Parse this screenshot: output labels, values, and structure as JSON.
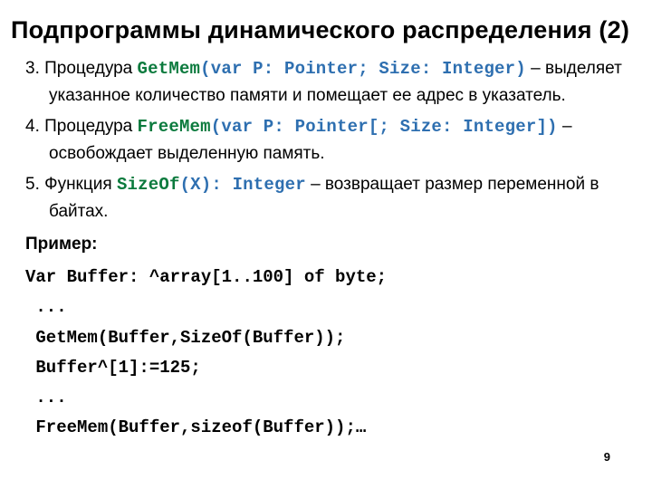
{
  "title": "Подпрограммы динамического распределения (2)",
  "items": {
    "i3": {
      "lead": "3. Процедура ",
      "proc": "GetMem",
      "sig_open": "(",
      "sig_var": "var",
      "sig_mid1": " P: ",
      "sig_t1": "Pointer",
      "sig_sep1": "; Size: ",
      "sig_t2": "Integer",
      "sig_close": ")",
      "dash": " – ",
      "tail": "выделяет указанное количество памяти и помещает ее адрес в указатель."
    },
    "i4": {
      "lead": "4. Процедура ",
      "proc": "FreeMem",
      "sig_open": "(",
      "sig_var": "var",
      "sig_mid1": " P: ",
      "sig_t1": "Pointer",
      "sig_sep1": "[; Size: ",
      "sig_t2": "Integer",
      "sig_close": "])",
      "dash": " –",
      "tail": "освобождает выделенную память."
    },
    "i5": {
      "lead": "5. Функция ",
      "proc": "SizeOf",
      "sig_open": "(X): ",
      "sig_t1": "Integer",
      "dash": " – ",
      "tail1": "возвращает размер переменной в",
      "tail2": "байтах."
    }
  },
  "example_label": "Пример:",
  "code": "Var Buffer: ^array[1..100] of byte;\n ...\n GetMem(Buffer,SizeOf(Buffer));\n Buffer^[1]:=125;\n ...\n FreeMem(Buffer,sizeof(Buffer));…",
  "page_number": "9"
}
